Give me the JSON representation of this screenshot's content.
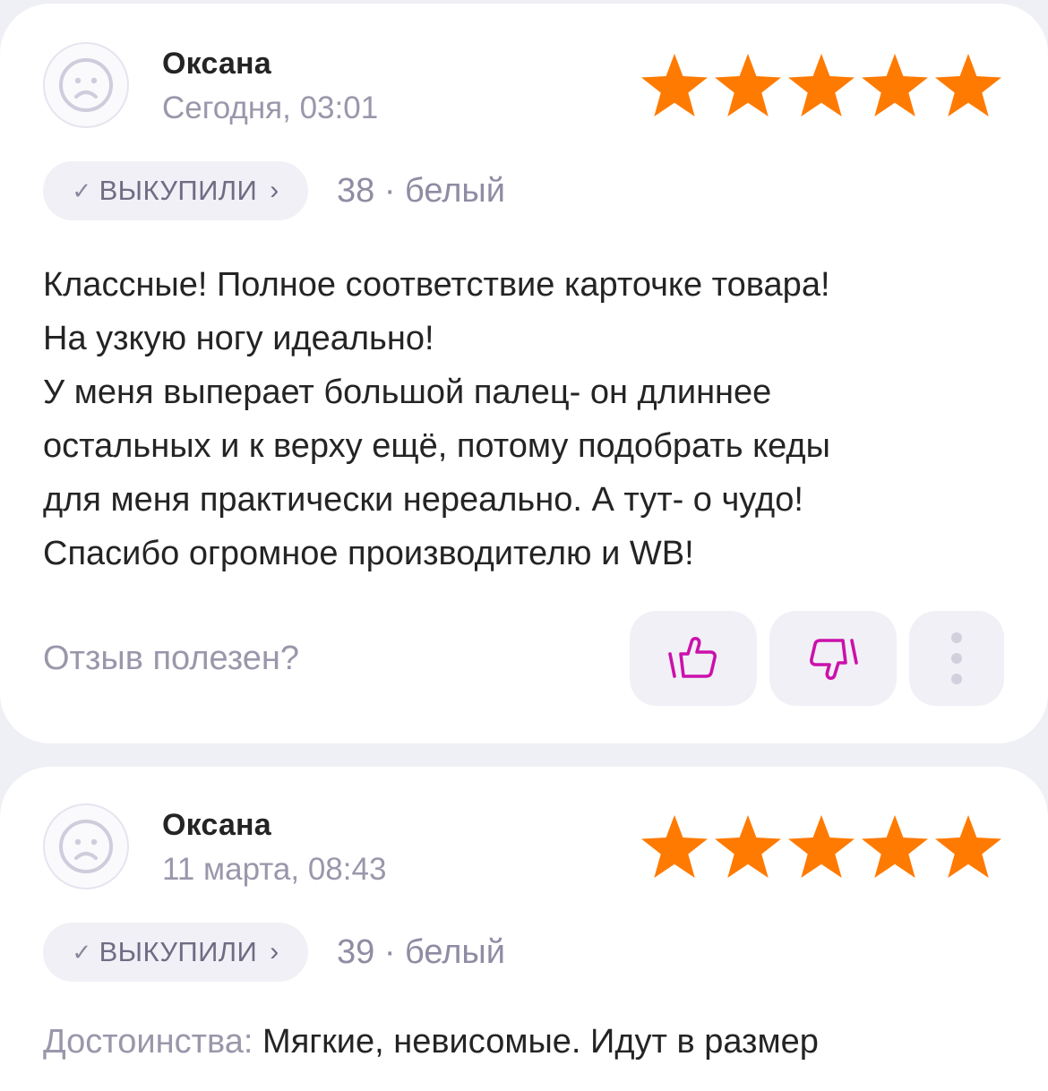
{
  "reviews": [
    {
      "author": "Оксана",
      "date": "Сегодня, 03:01",
      "rating": 5,
      "bought_label": "ВЫКУПИЛИ",
      "variant": "38 · белый",
      "text_lines": [
        "Классные! Полное соответствие карточке товара!",
        "На узкую ногу идеально!",
        "У меня выперает большой палец- он длиннее",
        "остальных и к верху ещё, потому подобрать кеды",
        "для меня практически нереально. А тут- о чудо!",
        "Спасибо огромное производителю и WB!"
      ],
      "helpful_question": "Отзыв полезен?"
    },
    {
      "author": "Оксана",
      "date": "11 марта, 08:43",
      "rating": 5,
      "bought_label": "ВЫКУПИЛИ",
      "variant": "39 · белый",
      "pros_label": "Достоинства:",
      "pros_text": " Мягкие, невисомые. Идут в размер"
    }
  ],
  "icons": {
    "avatar": "sad-face-avatar-icon",
    "star": "star-icon",
    "like": "thumbs-up-icon",
    "dislike": "thumbs-down-icon",
    "more": "more-vertical-icon",
    "check": "checkmark-icon",
    "chevron": "chevron-right-icon"
  },
  "colors": {
    "star": "#ff7a00",
    "vote_icon": "#cb11ab",
    "muted_text": "#9a97ab",
    "card_bg": "#ffffff",
    "page_bg": "#efeff6"
  }
}
